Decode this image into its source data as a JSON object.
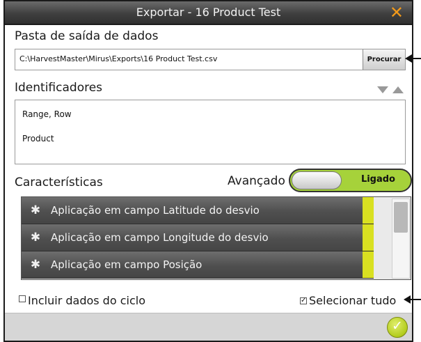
{
  "window": {
    "title": "Exportar - 16 Product Test",
    "close_glyph": "✕"
  },
  "output_folder": {
    "label": "Pasta de saída de dados",
    "path": "C:\\HarvestMaster\\Mirus\\Exports\\16 Product Test.csv",
    "browse_label": "Procurar"
  },
  "identifiers": {
    "label": "Identificadores",
    "items": [
      "Range, Row",
      "Product"
    ]
  },
  "characteristics": {
    "label": "Características",
    "advanced_label": "Avançado",
    "toggle_label": "Ligado",
    "toggle_on": true,
    "icon": "satellite-icon",
    "items": [
      "Aplicação em campo Latitude do desvio",
      "Aplicação em campo Longitude do desvio",
      "Aplicação em campo Posição"
    ]
  },
  "options": {
    "include_cycle_label": "Incluir dados do ciclo",
    "include_cycle_checked": false,
    "select_all_label": "Selecionar tudo",
    "select_all_checked": true,
    "check_glyph": "✓"
  },
  "footer": {
    "ok_glyph": "✓"
  },
  "colors": {
    "accent_green": "#a6d23a",
    "selection_yellow": "#d9e021",
    "close_orange": "#f39a1a",
    "row_gray": "#555555"
  }
}
